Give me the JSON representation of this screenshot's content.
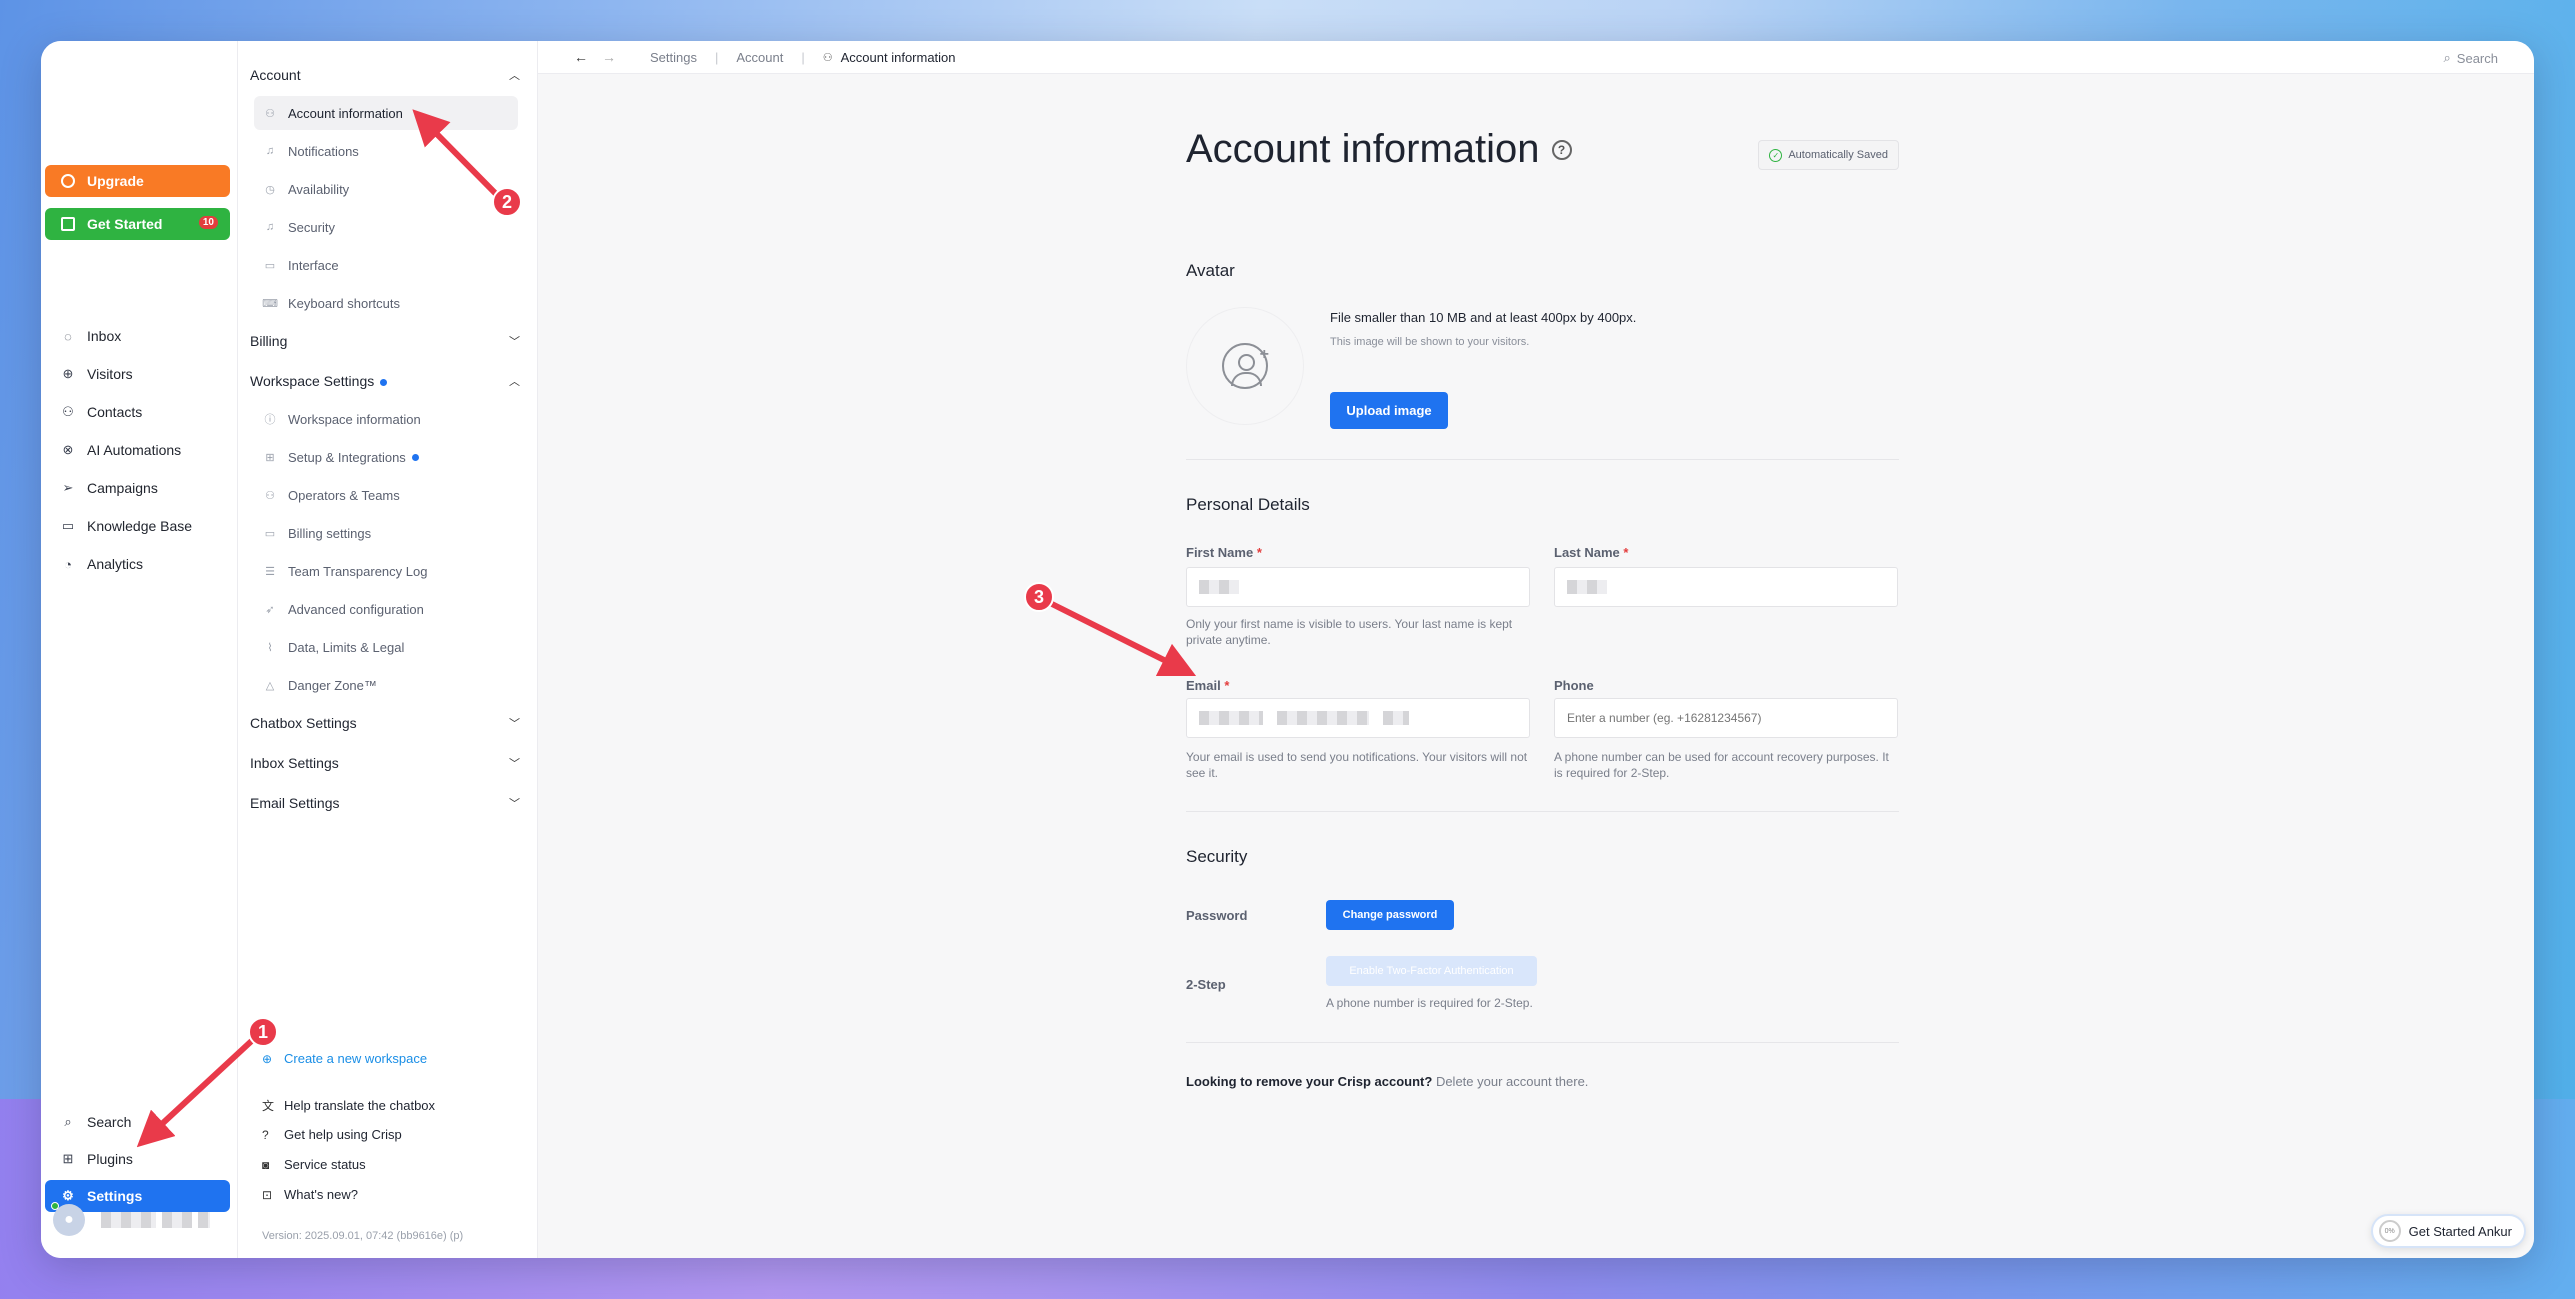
{
  "sidebar": {
    "upgrade": "Upgrade",
    "get_started": "Get Started",
    "get_started_badge": "10",
    "nav": [
      "Inbox",
      "Visitors",
      "Contacts",
      "AI Automations",
      "Campaigns",
      "Knowledge Base",
      "Analytics"
    ],
    "bottom": [
      "Search",
      "Plugins",
      "Settings"
    ]
  },
  "settings_nav": {
    "account": "Account",
    "account_items": [
      "Account information",
      "Notifications",
      "Availability",
      "Security",
      "Interface",
      "Keyboard shortcuts"
    ],
    "billing": "Billing",
    "workspace": "Workspace Settings",
    "workspace_items": [
      "Workspace information",
      "Setup & Integrations",
      "Operators & Teams",
      "Billing settings",
      "Team Transparency Log",
      "Advanced configuration",
      "Data, Limits & Legal",
      "Danger Zone™"
    ],
    "chatbox": "Chatbox Settings",
    "inbox": "Inbox Settings",
    "email": "Email Settings",
    "create_workspace": "Create a new workspace",
    "links": [
      "Help translate the chatbox",
      "Get help using Crisp",
      "Service status",
      "What's new?"
    ],
    "version": "Version: 2025.09.01, 07:42 (bb9616e) (p)"
  },
  "topbar": {
    "crumbs": [
      "Settings",
      "Account"
    ],
    "current": "Account information",
    "search": "Search"
  },
  "page": {
    "title": "Account information",
    "saved": "Automatically Saved",
    "avatar": {
      "heading": "Avatar",
      "file_title": "File smaller than 10 MB and at least 400px by 400px.",
      "file_sub": "This image will be shown to your visitors.",
      "upload": "Upload image"
    },
    "personal": {
      "heading": "Personal Details",
      "first_name": "First Name",
      "last_name": "Last Name",
      "name_help": "Only your first name is visible to users. Your last name is kept private anytime.",
      "email": "Email",
      "email_help": "Your email is used to send you notifications. Your visitors will not see it.",
      "phone": "Phone",
      "phone_placeholder": "Enter a number (eg. +16281234567)",
      "phone_help": "A phone number can be used for account recovery purposes. It is required for 2-Step.",
      "required_mark": "*"
    },
    "security": {
      "heading": "Security",
      "password": "Password",
      "change_password": "Change password",
      "two_step": "2-Step",
      "enable_2fa": "Enable Two-Factor Authentication",
      "phone_required": "A phone number is required for 2-Step."
    },
    "remove": {
      "text": "Looking to remove your Crisp account?",
      "link": "Delete your account there."
    }
  },
  "widget": {
    "progress": "0%",
    "label": "Get Started Ankur"
  },
  "annotations": [
    "1",
    "2",
    "3"
  ],
  "colors": {
    "accent": "#1f73f0",
    "upgrade": "#f97a25",
    "get_started": "#2fb341",
    "annotation": "#e93a4a"
  }
}
